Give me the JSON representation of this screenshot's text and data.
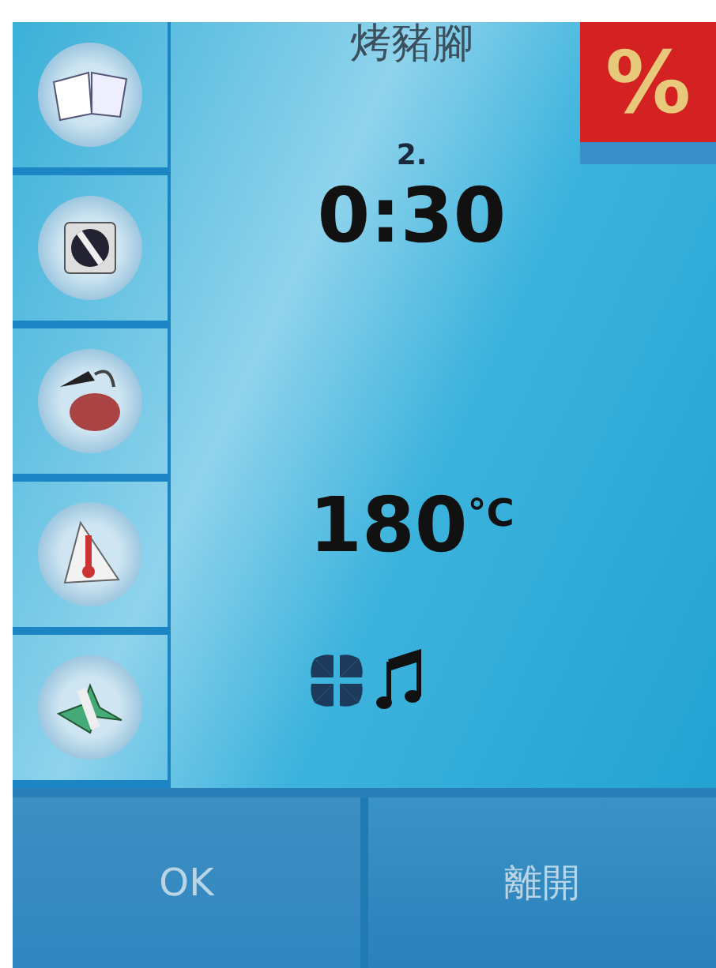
{
  "program": {
    "name": "烤豬腳",
    "step": "2.",
    "time": "0:30",
    "temperature": "180",
    "unit": "°C"
  },
  "badge": {
    "label": "%"
  },
  "buttons": [
    {
      "label": "OK",
      "kind": "confirm"
    },
    {
      "label": "離開",
      "kind": "exit"
    }
  ]
}
